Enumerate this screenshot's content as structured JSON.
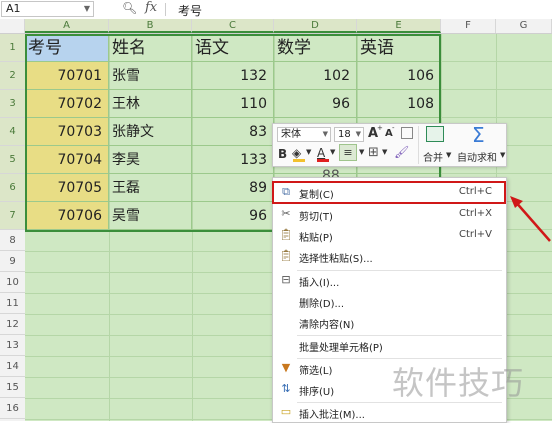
{
  "formula_bar": {
    "cell_ref": "A1",
    "fx_label": "fx",
    "value": "考号"
  },
  "columns": [
    "A",
    "B",
    "C",
    "D",
    "E",
    "F",
    "G"
  ],
  "rows": [
    "1",
    "2",
    "3",
    "4",
    "5",
    "6",
    "7",
    "8",
    "9",
    "10",
    "11",
    "12",
    "13",
    "14",
    "15",
    "16"
  ],
  "table": {
    "headers": [
      "考号",
      "姓名",
      "语文",
      "数学",
      "英语"
    ],
    "rows": [
      [
        "70701",
        "张雪",
        "132",
        "102",
        "106"
      ],
      [
        "70702",
        "王林",
        "110",
        "96",
        "108"
      ],
      [
        "70703",
        "张静文",
        "83",
        "",
        ""
      ],
      [
        "70704",
        "李昊",
        "133",
        "",
        ""
      ],
      [
        "70705",
        "王磊",
        "89",
        "",
        ""
      ],
      [
        "70706",
        "吴雪",
        "96",
        "",
        ""
      ]
    ],
    "partial_values": {
      "row4_D": "88",
      "row5_E": "99"
    }
  },
  "mini_toolbar": {
    "font_name": "宋体",
    "font_size": "18",
    "grow_font": "A",
    "shrink_font": "A",
    "bold": "B",
    "font_color_letter": "A",
    "merge_label": "合并",
    "autosum_label": "自动求和"
  },
  "context_menu": {
    "items": [
      {
        "label": "复制(C)",
        "shortcut": "Ctrl+C",
        "icon": "copy-icon"
      },
      {
        "label": "剪切(T)",
        "shortcut": "Ctrl+X",
        "icon": "cut-icon"
      },
      {
        "label": "粘贴(P)",
        "shortcut": "Ctrl+V",
        "icon": "paste-icon"
      },
      {
        "label": "选择性粘贴(S)...",
        "shortcut": "",
        "icon": "paste-special-icon"
      },
      {
        "label": "插入(I)...",
        "shortcut": "",
        "icon": "insert-icon"
      },
      {
        "label": "删除(D)...",
        "shortcut": "",
        "icon": ""
      },
      {
        "label": "清除内容(N)",
        "shortcut": "",
        "icon": ""
      },
      {
        "label": "批量处理单元格(P)",
        "shortcut": "",
        "icon": ""
      },
      {
        "label": "筛选(L)",
        "shortcut": "",
        "icon": "filter-icon"
      },
      {
        "label": "排序(U)",
        "shortcut": "",
        "icon": "sort-icon"
      },
      {
        "label": "插入批注(M)...",
        "shortcut": "",
        "icon": "comment-icon"
      }
    ]
  },
  "watermark": "软件技巧",
  "colors": {
    "grid_bg": "#cfe8c3",
    "id_col": "#e8dd85",
    "header_bg": "#b7d3ee",
    "border": "#3b8e3b",
    "highlight": "#d01818"
  }
}
